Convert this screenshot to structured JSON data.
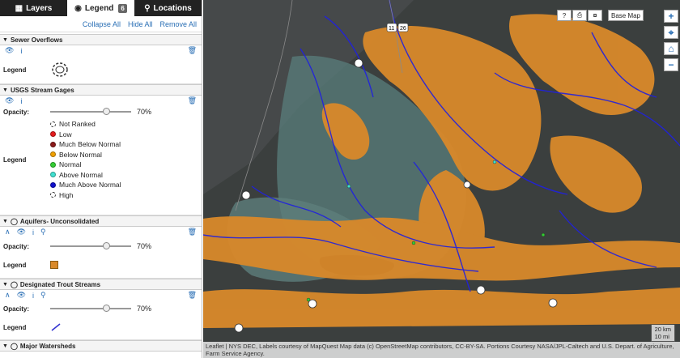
{
  "tabs": [
    {
      "label": "Layers",
      "icon": "map-icon"
    },
    {
      "label": "Legend",
      "badge": "6",
      "icon": "globe-icon"
    },
    {
      "label": "Locations",
      "icon": "search-icon"
    }
  ],
  "actions": {
    "collapse": "Collapse All",
    "hide": "Hide All",
    "remove": "Remove All"
  },
  "layers": {
    "sewer": {
      "title": "Sewer Overflows",
      "legend_label": "Legend"
    },
    "gages": {
      "title": "USGS Stream Gages",
      "opacity_label": "Opacity:",
      "opacity": "70%",
      "opacity_fraction": 0.7,
      "legend_label": "Legend",
      "items": [
        {
          "label": "Not Ranked",
          "color": "#ffffff"
        },
        {
          "label": "Low",
          "color": "#e41a1c"
        },
        {
          "label": "Much Below Normal",
          "color": "#8b1a1a"
        },
        {
          "label": "Below Normal",
          "color": "#f0a000"
        },
        {
          "label": "Normal",
          "color": "#33cc33"
        },
        {
          "label": "Above Normal",
          "color": "#40e0d0"
        },
        {
          "label": "Much Above Normal",
          "color": "#1010cc"
        },
        {
          "label": "High",
          "color": "#000000"
        }
      ]
    },
    "aquifers": {
      "title": "Aquifers- Unconsolidated",
      "opacity_label": "Opacity:",
      "opacity": "70%",
      "opacity_fraction": 0.7,
      "legend_label": "Legend",
      "swatch_color": "#d9892a"
    },
    "trout": {
      "title": "Designated Trout Streams",
      "opacity_label": "Opacity:",
      "opacity": "70%",
      "opacity_fraction": 0.7,
      "legend_label": "Legend",
      "line_color": "#3030d0"
    },
    "watersheds": {
      "title": "Major Watersheds"
    }
  },
  "map": {
    "basemap_label": "Base Map",
    "help_label": "?",
    "scale_km": "20 km",
    "scale_mi": "10 mi",
    "highway": "11",
    "highway2": "26",
    "attribution": "Leaflet | NYS DEC, Labels courtesy of MapQuest  Map data (c) OpenStreetMap contributors, CC-BY-SA. Portions Courtesy NASA/JPL-Caltech and U.S. Depart. of Agriculture, Farm Service Agency.",
    "colors": {
      "land": "#3b3f3e",
      "aquifer": "#d9892a",
      "stream": "#2020e0",
      "wetland": "#6e9a9a"
    }
  }
}
